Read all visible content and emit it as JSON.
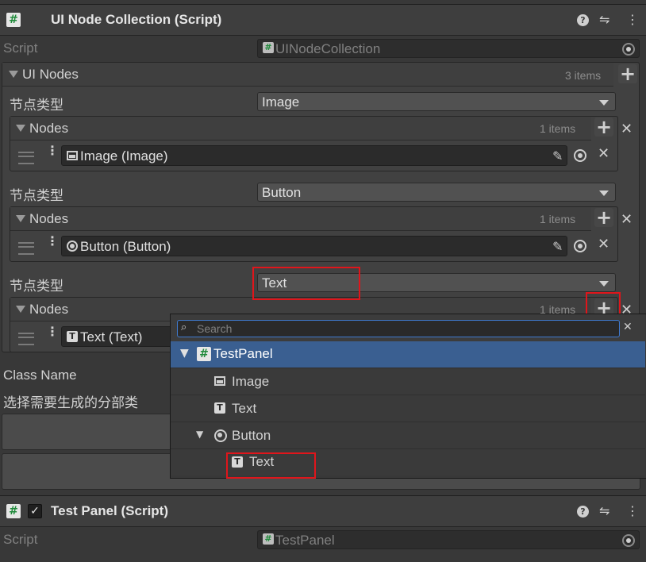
{
  "components": [
    {
      "title": "UI Node Collection (Script)",
      "script_label": "Script",
      "script_value": "UINodeCollection"
    },
    {
      "title": "Test Panel (Script)",
      "script_label": "Script",
      "script_value": "TestPanel"
    }
  ],
  "ui_nodes": {
    "label": "UI Nodes",
    "count": "3 items",
    "elements": [
      {
        "type_label": "节点类型",
        "type_value": "Image",
        "nodes_label": "Nodes",
        "nodes_count": "1 items",
        "node_ref": "Image (Image)",
        "node_icon": "image-icon"
      },
      {
        "type_label": "节点类型",
        "type_value": "Button",
        "nodes_label": "Nodes",
        "nodes_count": "1 items",
        "node_ref": "Button (Button)",
        "node_icon": "button-icon"
      },
      {
        "type_label": "节点类型",
        "type_value": "Text",
        "nodes_label": "Nodes",
        "nodes_count": "1 items",
        "node_ref": "Text (Text)",
        "node_icon": "text-icon"
      }
    ]
  },
  "class_name": {
    "label": "Class Name",
    "hint": "选择需要生成的分部类"
  },
  "popup": {
    "search_placeholder": "Search",
    "tree": [
      {
        "label": "TestPanel",
        "icon": "script-hash-icon",
        "selected": true,
        "expanded": true
      },
      {
        "label": "Image",
        "icon": "image-icon"
      },
      {
        "label": "Text",
        "icon": "text-icon"
      },
      {
        "label": "Button",
        "icon": "button-icon",
        "expanded": true
      },
      {
        "label": "Text",
        "icon": "text-icon"
      }
    ]
  },
  "icons": {
    "help": "help-icon",
    "presets": "presets-icon",
    "menu": "kebab-menu-icon",
    "add": "plus-icon",
    "remove": "close-icon",
    "pick": "object-picker-icon",
    "edit": "pencil-icon"
  },
  "colors": {
    "highlight_box": "#e0151b",
    "selected_row": "#3a5f91",
    "script_icon_hash": "#1f8a3a"
  },
  "glyphs": {
    "hash": "#",
    "help": "?",
    "presets": "⇋",
    "menu": "⋮",
    "plus": "+",
    "close": "✕",
    "pencil": "✎",
    "search": "⌕",
    "tri_right": "▶",
    "check": "✓",
    "text_glyph": "T"
  }
}
